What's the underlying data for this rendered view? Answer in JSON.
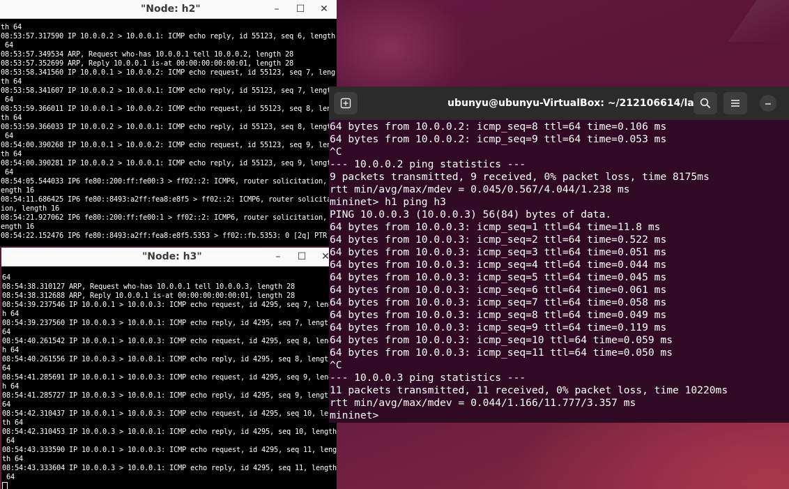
{
  "node_h2": {
    "title": "\"Node: h2\"",
    "lines": [
      "th 64",
      "08:53:57.317590 IP 10.0.0.2 > 10.0.0.1: ICMP echo reply, id 55123, seq 6, length",
      " 64",
      "08:53:57.349534 ARP, Request who-has 10.0.0.1 tell 10.0.0.2, length 28",
      "08:53:57.352699 ARP, Reply 10.0.0.1 is-at 00:00:00:00:00:01, length 28",
      "08:53:58.341560 IP 10.0.0.1 > 10.0.0.2: ICMP echo request, id 55123, seq 7, leng",
      "th 64",
      "08:53:58.341607 IP 10.0.0.2 > 10.0.0.1: ICMP echo reply, id 55123, seq 7, length",
      " 64",
      "08:53:59.366011 IP 10.0.0.1 > 10.0.0.2: ICMP echo request, id 55123, seq 8, leng",
      "th 64",
      "08:53:59.366033 IP 10.0.0.2 > 10.0.0.1: ICMP echo reply, id 55123, seq 8, length",
      " 64",
      "08:54:00.390268 IP 10.0.0.1 > 10.0.0.2: ICMP echo request, id 55123, seq 9, leng",
      "th 64",
      "08:54:00.390281 IP 10.0.0.2 > 10.0.0.1: ICMP echo reply, id 55123, seq 9, length",
      " 64",
      "08:54:05.544033 IP6 fe80::200:ff:fe00:3 > ff02::2: ICMP6, router solicitation, l",
      "ength 16",
      "08:54:11.686425 IP6 fe80::8493:a2ff:fea8:e8f5 > ff02::2: ICMP6, router solicitat",
      "ion, length 16",
      "08:54:21.927062 IP6 fe80::200:ff:fe00:1 > ff02::2: ICMP6, router solicitation, l",
      "ength 16",
      "08:54:22.152476 IP6 fe80::8493:a2ff:fea8:e8f5.5353 > ff02::fb.5353: 0 [2q] PTR"
    ]
  },
  "node_h3": {
    "title": "\"Node: h3\"",
    "lines": [
      "64",
      "08:54:38.310127 ARP, Request who-has 10.0.0.1 tell 10.0.0.3, length 28",
      "08:54:38.312688 ARP, Reply 10.0.0.1 is-at 00:00:00:00:00:01, length 28",
      "08:54:39.237546 IP 10.0.0.1 > 10.0.0.3: ICMP echo request, id 4295, seq 7, lengt",
      "h 64",
      "08:54:39.237560 IP 10.0.0.3 > 10.0.0.1: ICMP echo reply, id 4295, seq 7, length",
      "64",
      "08:54:40.261542 IP 10.0.0.1 > 10.0.0.3: ICMP echo request, id 4295, seq 8, lengt",
      "h 64",
      "08:54:40.261556 IP 10.0.0.3 > 10.0.0.1: ICMP echo reply, id 4295, seq 8, length",
      "64",
      "08:54:41.285691 IP 10.0.0.1 > 10.0.0.3: ICMP echo request, id 4295, seq 9, lengt",
      "h 64",
      "08:54:41.285727 IP 10.0.0.3 > 10.0.0.1: ICMP echo reply, id 4295, seq 9, length",
      "64",
      "08:54:42.310437 IP 10.0.0.1 > 10.0.0.3: ICMP echo request, id 4295, seq 10, leng",
      "th 64",
      "08:54:42.310453 IP 10.0.0.3 > 10.0.0.1: ICMP echo reply, id 4295, seq 10, length",
      " 64",
      "08:54:43.333590 IP 10.0.0.1 > 10.0.0.3: ICMP echo request, id 4295, seq 11, leng",
      "th 64",
      "08:54:43.333604 IP 10.0.0.3 > 10.0.0.1: ICMP echo reply, id 4295, seq 11, length",
      " 64"
    ]
  },
  "terminal": {
    "title": "ubunyu@ubunyu-VirtualBox: ~/212106614/lab5",
    "lines": [
      "64 bytes from 10.0.0.2: icmp_seq=8 ttl=64 time=0.106 ms",
      "64 bytes from 10.0.0.2: icmp_seq=9 ttl=64 time=0.053 ms",
      "^C",
      "--- 10.0.0.2 ping statistics ---",
      "9 packets transmitted, 9 received, 0% packet loss, time 8175ms",
      "rtt min/avg/max/mdev = 0.045/0.567/4.044/1.238 ms",
      "mininet> h1 ping h3",
      "PING 10.0.0.3 (10.0.0.3) 56(84) bytes of data.",
      "64 bytes from 10.0.0.3: icmp_seq=1 ttl=64 time=11.8 ms",
      "64 bytes from 10.0.0.3: icmp_seq=2 ttl=64 time=0.522 ms",
      "64 bytes from 10.0.0.3: icmp_seq=3 ttl=64 time=0.051 ms",
      "64 bytes from 10.0.0.3: icmp_seq=4 ttl=64 time=0.044 ms",
      "64 bytes from 10.0.0.3: icmp_seq=5 ttl=64 time=0.045 ms",
      "64 bytes from 10.0.0.3: icmp_seq=6 ttl=64 time=0.061 ms",
      "64 bytes from 10.0.0.3: icmp_seq=7 ttl=64 time=0.058 ms",
      "64 bytes from 10.0.0.3: icmp_seq=8 ttl=64 time=0.049 ms",
      "64 bytes from 10.0.0.3: icmp_seq=9 ttl=64 time=0.119 ms",
      "64 bytes from 10.0.0.3: icmp_seq=10 ttl=64 time=0.059 ms",
      "64 bytes from 10.0.0.3: icmp_seq=11 ttl=64 time=0.050 ms",
      "^C",
      "--- 10.0.0.3 ping statistics ---",
      "11 packets transmitted, 11 received, 0% packet loss, time 10220ms",
      "rtt min/avg/max/mdev = 0.044/1.166/11.777/3.357 ms"
    ],
    "prompt": "mininet> "
  },
  "colors": {
    "terminal_bg": "#300a24",
    "headerbar_bg": "#2b2b2b",
    "xterm_bg": "#000000",
    "desktop_bg": "#5b1436"
  }
}
